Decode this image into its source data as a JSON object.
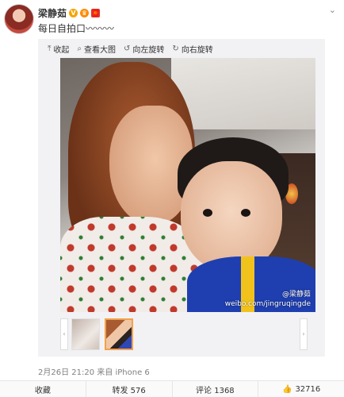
{
  "user": {
    "name": "梁静茹",
    "badges": [
      "V",
      "♛",
      "🧧"
    ]
  },
  "post": {
    "text": "每日自拍口〰〰〰"
  },
  "toolbar": {
    "collapse": "收起",
    "view_large": "查看大图",
    "rotate_left": "向左旋转",
    "rotate_right": "向右旋转"
  },
  "photo": {
    "watermark_name": "@梁静茹",
    "watermark_url": "weibo.com/jingruqingde"
  },
  "meta": {
    "date": "2月26日 21:20",
    "source_prefix": "来自",
    "source": "iPhone 6"
  },
  "footer": {
    "favorite": "收藏",
    "repost": "转发 576",
    "comment": "评论 1368",
    "like": "32716"
  },
  "icons": {
    "collapse": "arrow-up-icon",
    "view_large": "magnifier-icon",
    "rotate_left": "rotate-left-icon",
    "rotate_right": "rotate-right-icon",
    "like": "thumbs-up-icon"
  },
  "colors": {
    "accent_thumb_border": "#f2a14a",
    "meta_text": "#808080"
  }
}
